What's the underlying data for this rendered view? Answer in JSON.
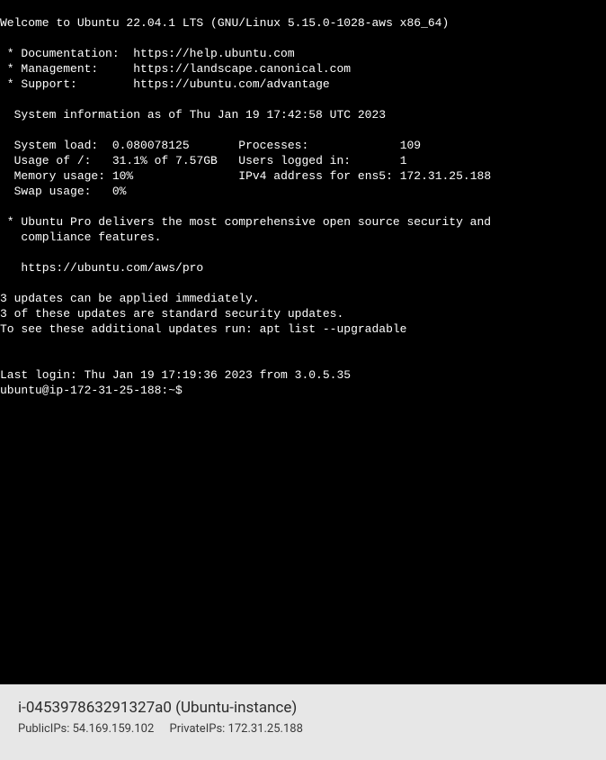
{
  "terminal": {
    "welcome": "Welcome to Ubuntu 22.04.1 LTS (GNU/Linux 5.15.0-1028-aws x86_64)",
    "links": {
      "doc_label": " * Documentation:  ",
      "doc_url": "https://help.ubuntu.com",
      "mgmt_label": " * Management:     ",
      "mgmt_url": "https://landscape.canonical.com",
      "sup_label": " * Support:        ",
      "sup_url": "https://ubuntu.com/advantage"
    },
    "sysinfo_header": "  System information as of Thu Jan 19 17:42:58 UTC 2023",
    "stats": {
      "row1_left_label": "  System load:  ",
      "row1_left_value": "0.080078125",
      "row1_right_label": "Processes:             ",
      "row1_right_value": "109",
      "row2_left_label": "  Usage of /:   ",
      "row2_left_value": "31.1% of 7.57GB",
      "row2_right_label": "Users logged in:       ",
      "row2_right_value": "1",
      "row3_left_label": "  Memory usage: ",
      "row3_left_value": "10%",
      "row3_right_label": "IPv4 address for ens5: ",
      "row3_right_value": "172.31.25.188",
      "row4_left_label": "  Swap usage:   ",
      "row4_left_value": "0%"
    },
    "pro_line1": " * Ubuntu Pro delivers the most comprehensive open source security and",
    "pro_line2": "   compliance features.",
    "pro_url": "   https://ubuntu.com/aws/pro",
    "updates_line1": "3 updates can be applied immediately.",
    "updates_line2": "3 of these updates are standard security updates.",
    "updates_line3": "To see these additional updates run: apt list --upgradable",
    "last_login": "Last login: Thu Jan 19 17:19:36 2023 from 3.0.5.35",
    "prompt": "ubuntu@ip-172-31-25-188:~$ "
  },
  "footer": {
    "instance_id": "i-045397863291327a0",
    "instance_name": "Ubuntu-instance",
    "public_ip_label": "PublicIPs:",
    "public_ip": "54.169.159.102",
    "private_ip_label": "PrivateIPs:",
    "private_ip": "172.31.25.188"
  }
}
